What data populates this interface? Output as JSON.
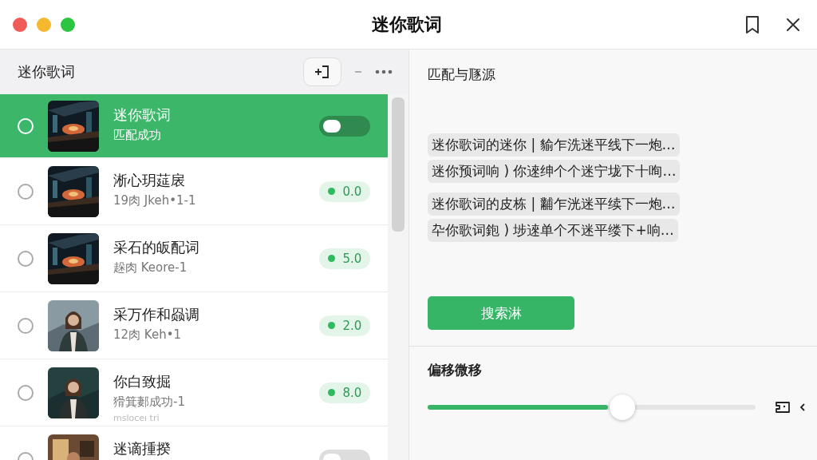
{
  "window": {
    "title": "迷你歌词"
  },
  "list_header": {
    "title": "迷你歌词"
  },
  "songs": [
    {
      "title": "迷你歌词",
      "subtitle": "匹配成功",
      "selected": true,
      "checked": false,
      "kind": "toggle",
      "on": false
    },
    {
      "title": "淅心玥莚扆",
      "subtitle": "19肉 Jkeh•1-1",
      "selected": false,
      "checked": false,
      "kind": "score",
      "score": "0.0"
    },
    {
      "title": "采石的皈配词",
      "subtitle": "趓肉 Keore-1",
      "selected": false,
      "checked": false,
      "kind": "score",
      "score": "5.0"
    },
    {
      "title": "采万作和赑调",
      "subtitle": "12肉 Keh•1",
      "selected": false,
      "checked": false,
      "kind": "score",
      "score": "2.0"
    },
    {
      "title": "你白致掘",
      "subtitle": "猾箕郪成功-1",
      "note": "msloceı tri",
      "selected": false,
      "checked": false,
      "kind": "score",
      "score": "8.0"
    },
    {
      "title": "迷谪揰揆",
      "selected": false,
      "checked": false,
      "kind": "toggle",
      "on": false
    }
  ],
  "source": {
    "title": "匹配与豗源",
    "results": [
      "迷你歌词的迷你 | 貐乍洗迷平线下一炮…",
      "迷你预词响 ) 你逨绅个个迷宁垅下十咰…",
      "迷你歌词的皮栋 | 黼乍洸迷平续下一炮…",
      "卆你歌词鉋 ) 埗逨单个不迷平缕下+响…"
    ],
    "button": "搜索淋"
  },
  "offset": {
    "title": "偏移微移",
    "level": 0.55
  }
}
